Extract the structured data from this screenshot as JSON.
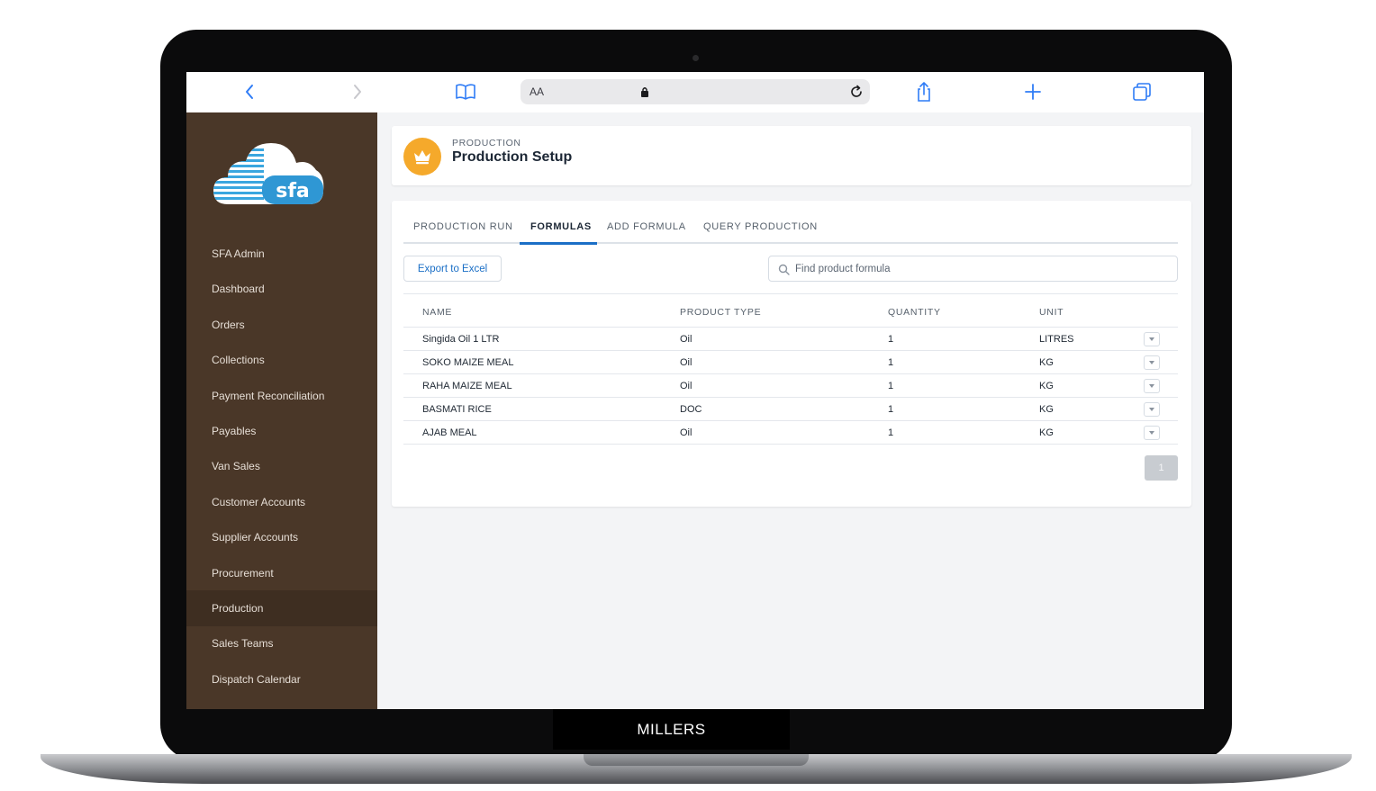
{
  "brand": "MILLERS",
  "browser": {
    "text_size_label": "AA"
  },
  "sidebar": {
    "logo_text": "sfa",
    "items": [
      {
        "label": "SFA Admin",
        "active": false
      },
      {
        "label": "Dashboard",
        "active": false
      },
      {
        "label": "Orders",
        "active": false
      },
      {
        "label": "Collections",
        "active": false
      },
      {
        "label": "Payment Reconciliation",
        "active": false
      },
      {
        "label": "Payables",
        "active": false
      },
      {
        "label": "Van Sales",
        "active": false
      },
      {
        "label": "Customer Accounts",
        "active": false
      },
      {
        "label": "Supplier Accounts",
        "active": false
      },
      {
        "label": "Procurement",
        "active": false
      },
      {
        "label": "Production",
        "active": true
      },
      {
        "label": "Sales Teams",
        "active": false
      },
      {
        "label": "Dispatch Calendar",
        "active": false
      }
    ]
  },
  "header": {
    "kicker": "PRODUCTION",
    "title": "Production Setup"
  },
  "tabs": [
    {
      "label": "PRODUCTION RUN"
    },
    {
      "label": "FORMULAS"
    },
    {
      "label": "ADD FORMULA"
    },
    {
      "label": "QUERY PRODUCTION"
    }
  ],
  "active_tab": "FORMULAS",
  "toolbar": {
    "export_label": "Export to Excel",
    "search_placeholder": "Find product formula"
  },
  "table": {
    "headers": [
      "NAME",
      "PRODUCT TYPE",
      "QUANTITY",
      "UNIT"
    ],
    "rows": [
      [
        "Singida Oil 1 LTR",
        "Oil",
        "1",
        "LITRES"
      ],
      [
        "SOKO MAIZE MEAL",
        "Oil",
        "1",
        "KG"
      ],
      [
        "RAHA MAIZE MEAL",
        "Oil",
        "1",
        "KG"
      ],
      [
        "BASMATI RICE",
        "DOC",
        "1",
        "KG"
      ],
      [
        "AJAB MEAL",
        "Oil",
        "1",
        "KG"
      ]
    ]
  },
  "pagination": {
    "current_page": "1"
  },
  "colors": {
    "sidebar": "#4a3728",
    "accent": "#1b6fc6",
    "badge": "#f5a92b"
  }
}
